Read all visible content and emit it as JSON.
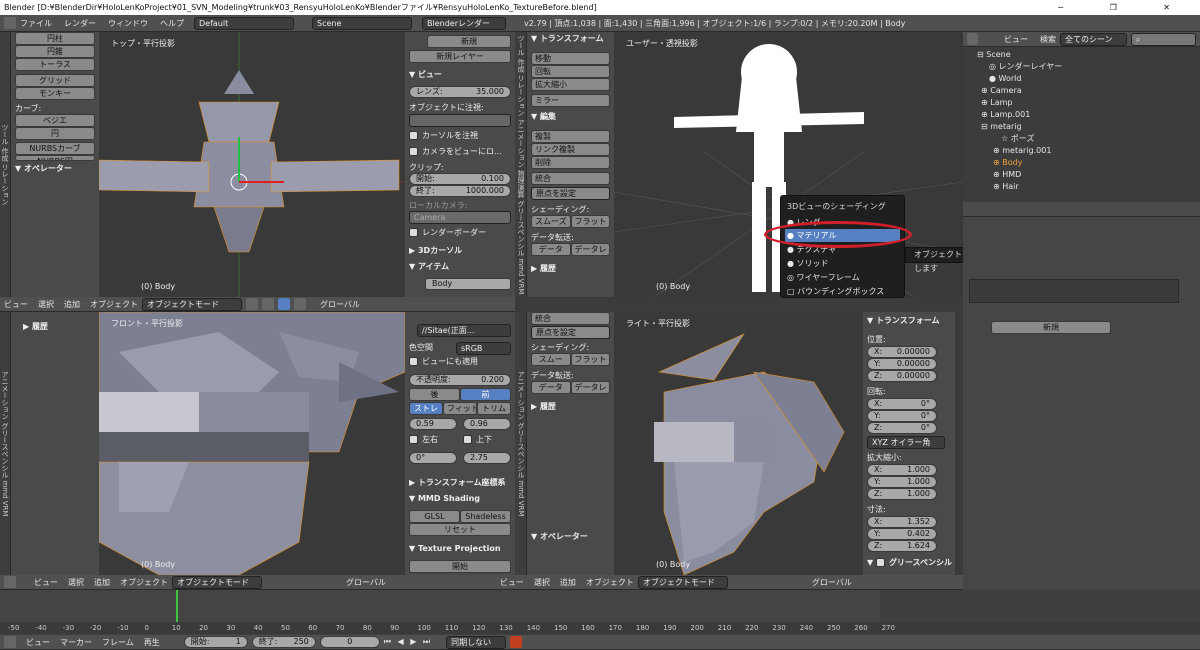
{
  "window": {
    "title": "Blender [D:¥BlenderDir¥HoloLenKoProject¥01_SVN_Modeling¥trunk¥03_RensyuHoloLenKo¥Blenderファイル¥RensyuHoloLenKo_TextureBefore.blend]"
  },
  "menubar": {
    "file": "ファイル",
    "render": "レンダー",
    "window": "ウィンドウ",
    "help": "ヘルプ",
    "layout": "Default",
    "scene": "Scene",
    "engine": "Blenderレンダー",
    "stats": "v2.79 | 頂点:1,038 | 面:1,430 | 三角面:1,996 | オブジェクト:1/6 | ランプ:0/2 | メモリ:20.20M | Body"
  },
  "toolshelf_top": {
    "items": [
      "円柱",
      "円錐",
      "トーラス"
    ],
    "grid": "グリッド",
    "monkey": "モンキー",
    "curve_label": "カーブ:",
    "bezier": "ベジエ",
    "circle": "円",
    "nurbs_curve": "NURBSカーブ",
    "nurbs_circle": "NURBS円",
    "operator": "オペレーター"
  },
  "viewport_tl": {
    "title": "トップ・平行投影",
    "footer": "(0) Body"
  },
  "props_tl": {
    "new": "新規",
    "new_layer": "新規レイヤー",
    "view": "ビュー",
    "lens_label": "レンズ:",
    "lens_value": "35.000",
    "lock": "オブジェクトに注視:",
    "cursor_lock": "カーソルを注視",
    "camera_to_view": "カメラをビューにロ...",
    "clip": "クリップ:",
    "clip_start_label": "開始:",
    "clip_start": "0.100",
    "clip_end_label": "終了:",
    "clip_end": "1000.000",
    "local_camera": "ローカルカメラ:",
    "camera": "Camera",
    "render_border": "レンダーボーダー",
    "cursor3d": "3Dカーソル",
    "item": "アイテム",
    "item_name": "Body"
  },
  "header_tl": {
    "view": "ビュー",
    "select": "選択",
    "add": "追加",
    "object": "オブジェクト",
    "mode": "オブジェクトモード",
    "pivot": "グローバル"
  },
  "toolshelf_tr": {
    "transform": "トランスフォーム",
    "move": "移動",
    "rotate": "回転",
    "scale": "拡大縮小",
    "mirror": "ミラー",
    "edit": "編集",
    "duplicate": "複製",
    "link_dup": "リンク複製",
    "delete": "削除",
    "join": "統合",
    "origin": "原点を設定",
    "shading": "シェーディング:",
    "smooth": "スムーズ",
    "flat": "フラット",
    "data_transfer": "データ転送:",
    "data": "データ",
    "data_layer": "データレ",
    "history": "履歴"
  },
  "viewport_tr": {
    "title": "ユーザー・透視投影",
    "footer": "(0) Body"
  },
  "shading_menu": {
    "title": "3Dビューのシェーディング",
    "items": [
      "レンダー",
      "マテリアル",
      "テクスチャ",
      "ソリッド",
      "ワイヤーフレーム",
      "バウンディングボックス"
    ],
    "selected": "マテリアル",
    "tooltip": "オブジェクトソリッドをGLSLマテリアルで表示します"
  },
  "outliner": {
    "header": {
      "view": "ビュー",
      "search": "検索",
      "scenes": "全てのシーン"
    },
    "items": [
      "Scene",
      "レンダーレイヤー",
      "World",
      "Camera",
      "Lamp",
      "Lamp.001",
      "metarig",
      "ポーズ",
      "metarig.001",
      "Body",
      "HMD",
      "Hair"
    ]
  },
  "props_right": {
    "new": "新規"
  },
  "viewport_bl": {
    "title": "フロント・平行投影",
    "footer": "(0) Body",
    "history": "履歴"
  },
  "props_bl": {
    "image": "//Sitae(正面...",
    "colorspace_label": "色空間",
    "colorspace": "sRGB",
    "apply_view": "ビューにも適用",
    "opacity_label": "不透明度:",
    "opacity": "0.200",
    "back": "後",
    "front": "前",
    "stretch": "ストレ",
    "fit": "フィット",
    "crop": "トリム",
    "v1": "0.59",
    "v2": "0.96",
    "flip_x": "左右",
    "flip_y": "上下",
    "rot": "0°",
    "size": "2.75",
    "transform_orient": "トランスフォーム座標系",
    "mmd_shading": "MMD Shading",
    "glsl": "GLSL",
    "shadeless": "Shadeless",
    "reset": "リセット",
    "texture_projection": "Texture Projection",
    "start": "開始"
  },
  "toolshelf_br": {
    "join": "統合",
    "origin": "原点を設定",
    "shading": "シェーディング:",
    "smooth": "スムー",
    "flat": "フラット",
    "data_transfer": "データ転送:",
    "data": "データ",
    "data_layer": "データレ",
    "history": "履歴",
    "operator": "オペレーター"
  },
  "viewport_br": {
    "title": "ライト・平行投影",
    "footer": "(0) Body"
  },
  "props_br": {
    "transform": "トランスフォーム",
    "location": "位置:",
    "loc": [
      "0.00000",
      "0.00000",
      "0.00000"
    ],
    "rotation": "回転:",
    "rot": [
      "0°",
      "0°",
      "0°"
    ],
    "rot_mode": "XYZ オイラー角",
    "scale": "拡大縮小:",
    "scl": [
      "1.000",
      "1.000",
      "1.000"
    ],
    "dimensions": "寸法:",
    "dim": [
      "1.352",
      "0.402",
      "1.624"
    ],
    "grease": "グリースペンシル",
    "axis": [
      "X:",
      "Y:",
      "Z:"
    ]
  },
  "timeline": {
    "ticks": [
      "-50",
      "-40",
      "-30",
      "-20",
      "-10",
      "0",
      "10",
      "20",
      "30",
      "40",
      "50",
      "60",
      "70",
      "80",
      "90",
      "100",
      "110",
      "120",
      "130",
      "140",
      "150",
      "160",
      "170",
      "180",
      "190",
      "200",
      "210",
      "220",
      "230",
      "240",
      "250",
      "260",
      "270"
    ],
    "view": "ビュー",
    "marker": "マーカー",
    "frame": "フレーム",
    "playback": "再生",
    "start_label": "開始:",
    "start": "1",
    "end_label": "終了:",
    "end": "250",
    "current": "0",
    "sync": "同期しない"
  },
  "side_tabs": [
    "ツール",
    "作成",
    "リレーション",
    "アニメーション",
    "物理演算",
    "グリースペンシル",
    "mmd",
    "VRM"
  ]
}
